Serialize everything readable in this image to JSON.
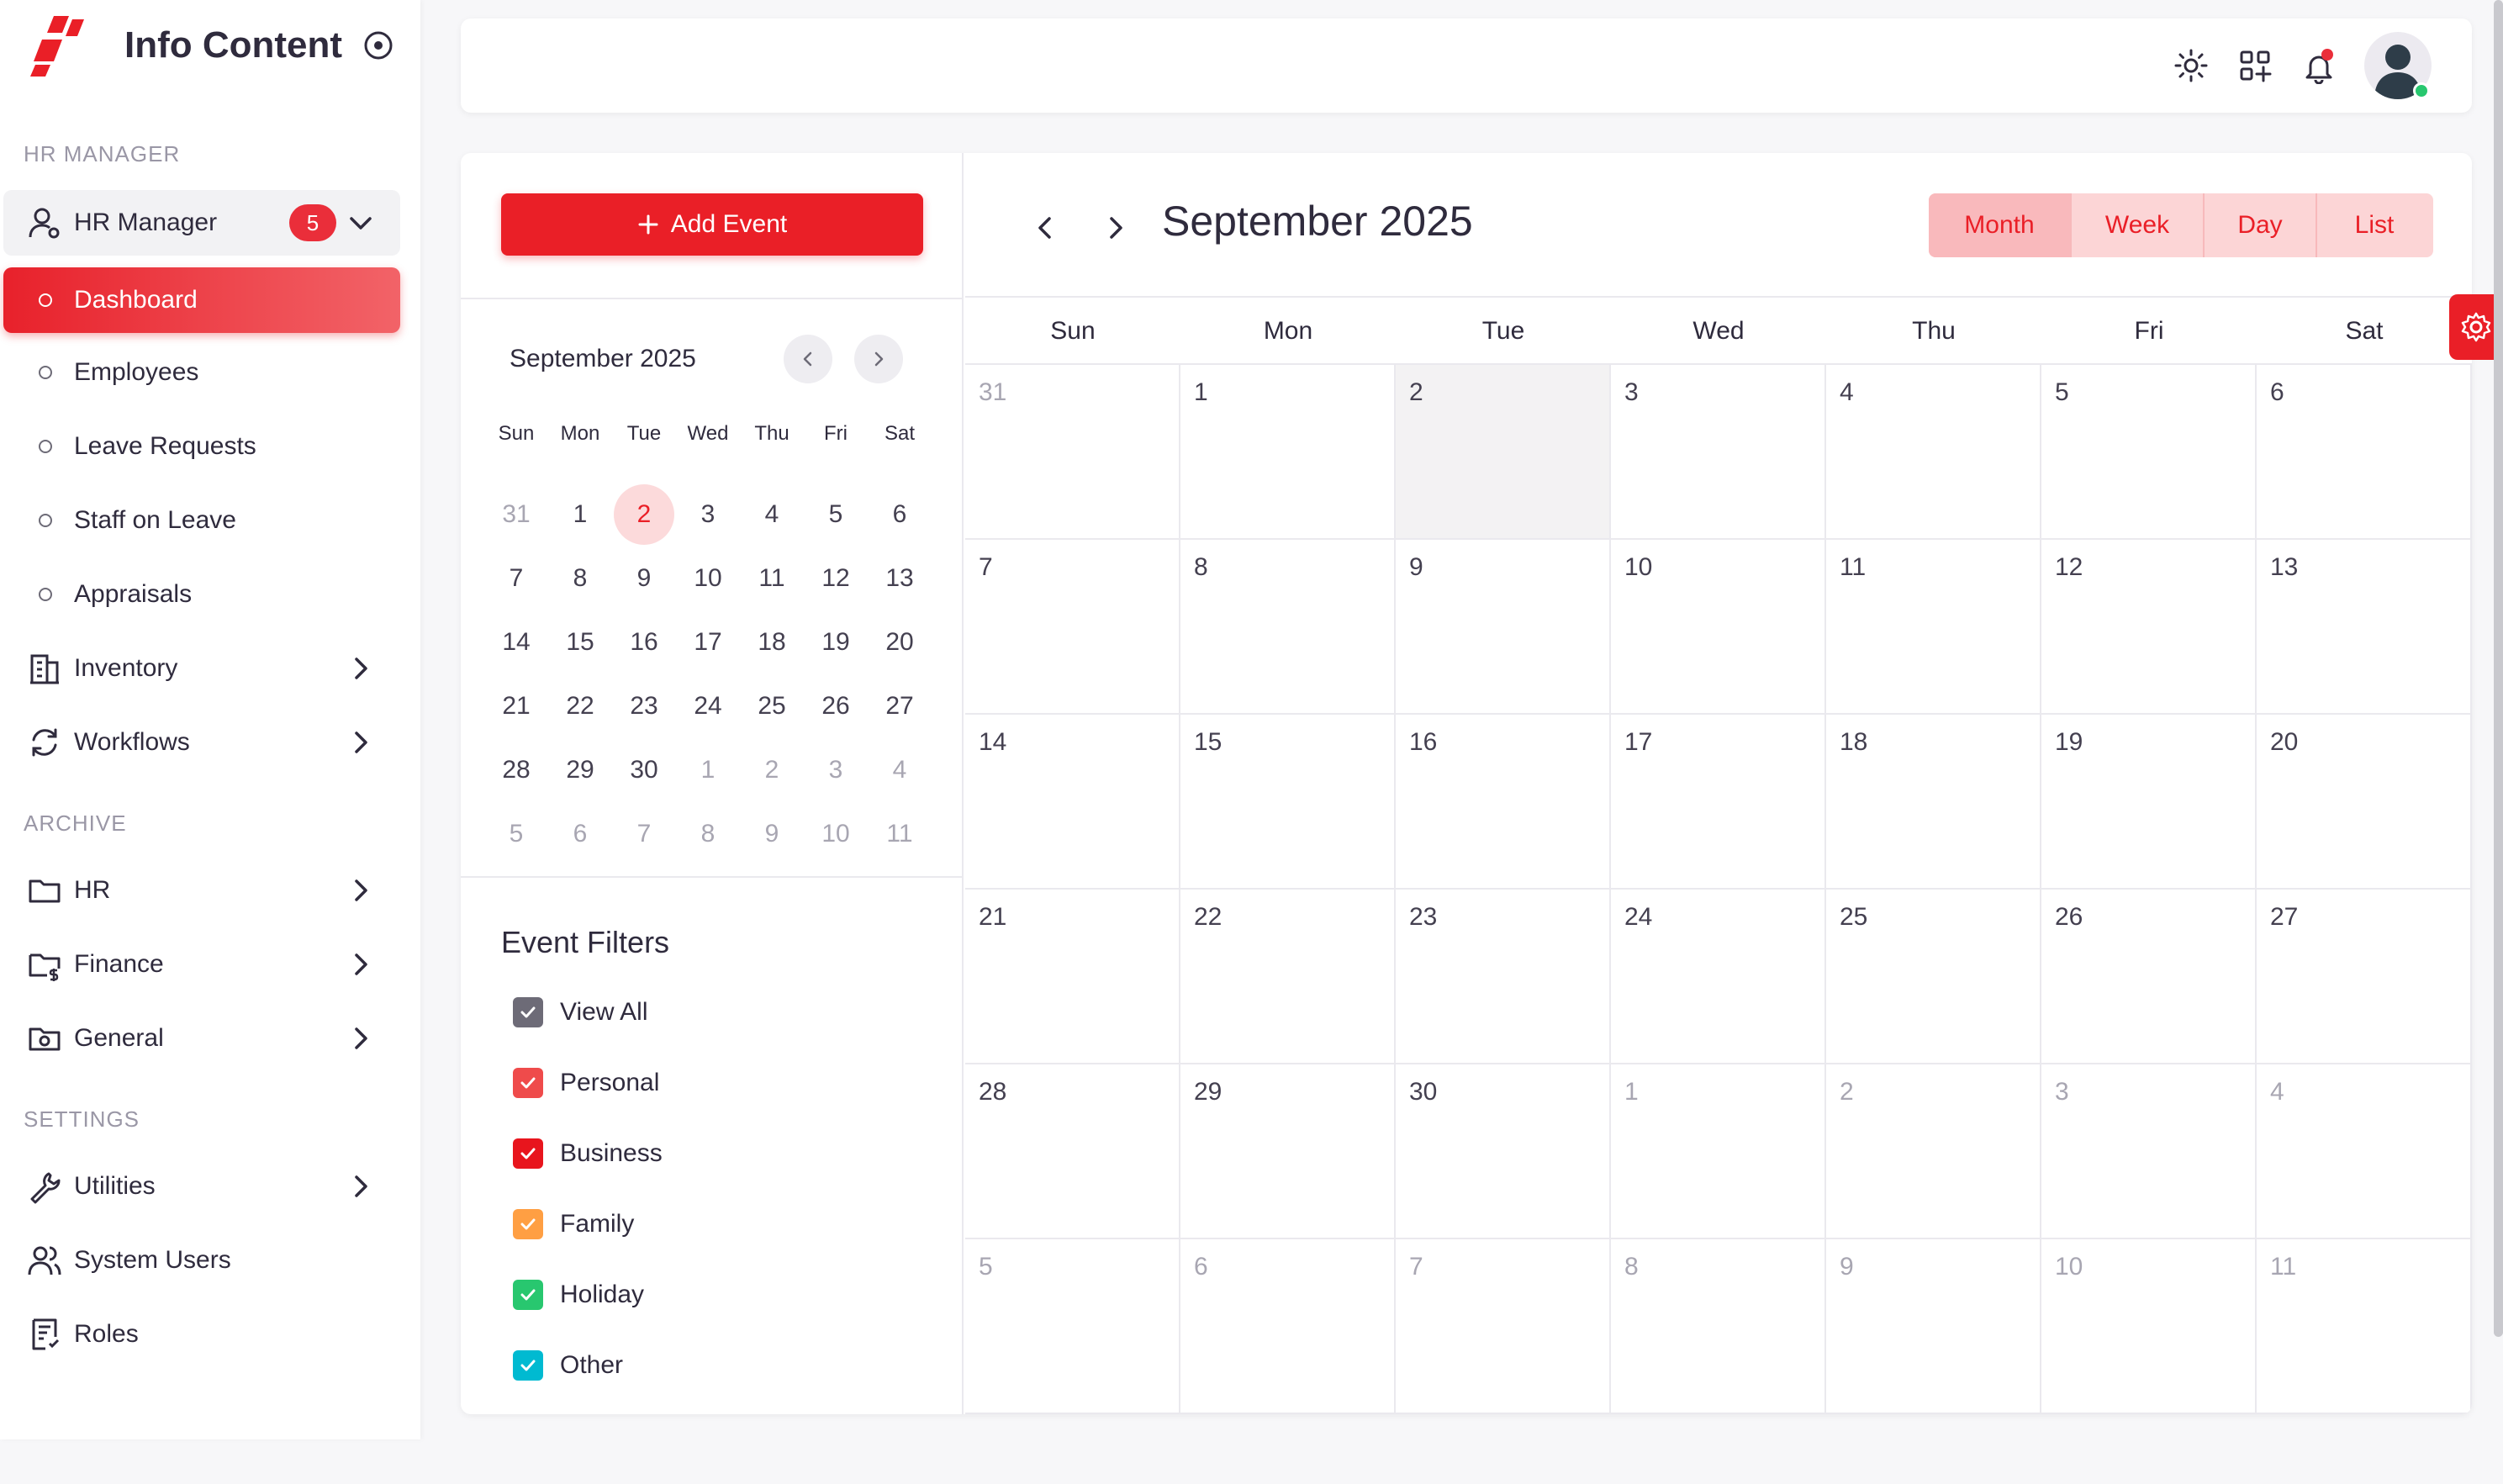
{
  "brand": {
    "title": "Info Content"
  },
  "sidebar": {
    "sections": {
      "hr_manager": "HR MANAGER",
      "archive": "ARCHIVE",
      "settings": "SETTINGS"
    },
    "group": {
      "label": "HR Manager",
      "badge": "5"
    },
    "sub_items": [
      "Dashboard",
      "Employees",
      "Leave Requests",
      "Staff on Leave",
      "Appraisals"
    ],
    "items": {
      "inventory": "Inventory",
      "workflows": "Workflows",
      "hr": "HR",
      "finance": "Finance",
      "general": "General",
      "utilities": "Utilities",
      "system_users": "System Users",
      "roles": "Roles"
    }
  },
  "topbar": {
    "icons": [
      "sun-icon",
      "grid-add-icon",
      "bell-icon",
      "avatar"
    ]
  },
  "left_panel": {
    "add_event": "Add Event",
    "mini_calendar": {
      "title": "September  2025",
      "dow": [
        "Sun",
        "Mon",
        "Tue",
        "Wed",
        "Thu",
        "Fri",
        "Sat"
      ],
      "today": "2"
    },
    "filters_title": "Event Filters",
    "filters": [
      {
        "label": "View All",
        "color": "#6d6b77"
      },
      {
        "label": "Personal",
        "color": "#ef4b4b"
      },
      {
        "label": "Business",
        "color": "#e8151d"
      },
      {
        "label": "Family",
        "color": "#ff9f43"
      },
      {
        "label": "Holiday",
        "color": "#28c76f"
      },
      {
        "label": "Other",
        "color": "#00bad1"
      }
    ]
  },
  "calendar": {
    "title": "September 2025",
    "views": [
      "Month",
      "Week",
      "Day",
      "List"
    ],
    "active_view": "Month",
    "dow": [
      "Sun",
      "Mon",
      "Tue",
      "Wed",
      "Thu",
      "Fri",
      "Sat"
    ],
    "weeks": [
      [
        "31",
        "1",
        "2",
        "3",
        "4",
        "5",
        "6"
      ],
      [
        "7",
        "8",
        "9",
        "10",
        "11",
        "12",
        "13"
      ],
      [
        "14",
        "15",
        "16",
        "17",
        "18",
        "19",
        "20"
      ],
      [
        "21",
        "22",
        "23",
        "24",
        "25",
        "26",
        "27"
      ],
      [
        "28",
        "29",
        "30",
        "1",
        "2",
        "3",
        "4"
      ],
      [
        "5",
        "6",
        "7",
        "8",
        "9",
        "10",
        "11"
      ]
    ],
    "today": "2",
    "accent": "#ea1f27"
  }
}
